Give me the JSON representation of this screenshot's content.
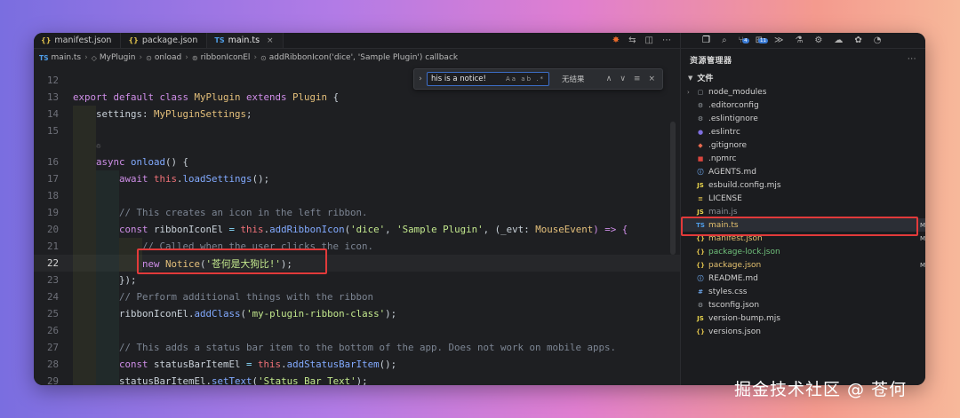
{
  "tabs": [
    {
      "icon": "{}",
      "label": "manifest.json"
    },
    {
      "icon": "{}",
      "label": "package.json"
    },
    {
      "icon": "TS",
      "label": "main.ts",
      "close": "×"
    }
  ],
  "breadcrumb": [
    "main.ts",
    "MyPlugin",
    "onload",
    "ribbonIconEl",
    "addRibbonIcon('dice', 'Sample Plugin') callback"
  ],
  "find": {
    "query": "his is a notice!",
    "options": "Aa ab .*",
    "result": "无结果",
    "chevron": "›"
  },
  "codelens": "♲ ",
  "code": {
    "line_numbers": [
      "12",
      "13",
      "14",
      "15",
      "",
      "16",
      "17",
      "18",
      "19",
      "20",
      "21",
      "22",
      "23",
      "24",
      "25",
      "26",
      "27",
      "28",
      "29"
    ],
    "l13": {
      "a": "export default class ",
      "b": "MyPlugin",
      "c": " extends ",
      "d": "Plugin",
      "e": " {"
    },
    "l14": {
      "a": "settings",
      "b": ": ",
      "c": "MyPluginSettings",
      "d": ";"
    },
    "l16": {
      "a": "async ",
      "b": "onload",
      "c": "() {"
    },
    "l17": {
      "a": "await ",
      "b": "this",
      "c": ".",
      "d": "loadSettings",
      "e": "();"
    },
    "l19": "// This creates an icon in the left ribbon.",
    "l20": {
      "a": "const ",
      "b": "ribbonIconEl",
      "c": " = ",
      "d": "this",
      "e": ".",
      "f": "addRibbonIcon",
      "g": "(",
      "h": "'dice'",
      "i": ", ",
      "j": "'Sample Plugin'",
      "k": ", (",
      "l": "_evt",
      "m": ": ",
      "n": "MouseEvent",
      "o": ") => {"
    },
    "l21": "// Called when the user clicks the icon.",
    "l22": {
      "a": "new ",
      "b": "Notice",
      "c": "(",
      "d": "'苍何是大狗比!'",
      "e": ");"
    },
    "l23": "});",
    "l24": "// Perform additional things with the ribbon",
    "l25": {
      "a": "ribbonIconEl",
      "b": ".",
      "c": "addClass",
      "d": "(",
      "e": "'my-plugin-ribbon-class'",
      "f": ");"
    },
    "l27": "// This adds a status bar item to the bottom of the app. Does not work on mobile apps.",
    "l28": {
      "a": "const ",
      "b": "statusBarItemEl",
      "c": " = ",
      "d": "this",
      "e": ".",
      "f": "addStatusBarItem",
      "g": "();"
    },
    "l29": {
      "a": "statusBarItemEl",
      "b": ".",
      "c": "setText",
      "d": "(",
      "e": "'Status Bar Text'",
      "f": ");"
    }
  },
  "sidebar": {
    "title": "资源管理器",
    "more": "···",
    "section": "文件",
    "items": [
      {
        "icon": "▢",
        "name": "node_modules",
        "folder": true
      },
      {
        "icon": "⚙",
        "name": ".editorconfig"
      },
      {
        "icon": "⚙",
        "name": ".eslintignore"
      },
      {
        "icon": "●",
        "name": ".eslintrc"
      },
      {
        "icon": "◆",
        "name": ".gitignore"
      },
      {
        "icon": "■",
        "name": ".npmrc"
      },
      {
        "icon": "ⓘ",
        "name": "AGENTS.md"
      },
      {
        "icon": "JS",
        "name": "esbuild.config.mjs"
      },
      {
        "icon": "≡",
        "name": "LICENSE"
      },
      {
        "icon": "JS",
        "name": "main.js"
      },
      {
        "icon": "TS",
        "name": "main.ts",
        "status": "M"
      },
      {
        "icon": "{}",
        "name": "manifest.json",
        "status": "M"
      },
      {
        "icon": "{}",
        "name": "package-lock.json"
      },
      {
        "icon": "{}",
        "name": "package.json",
        "status": "M"
      },
      {
        "icon": "ⓘ",
        "name": "README.md"
      },
      {
        "icon": "#",
        "name": "styles.css"
      },
      {
        "icon": "⚙",
        "name": "tsconfig.json"
      },
      {
        "icon": "JS",
        "name": "version-bump.mjs"
      },
      {
        "icon": "{}",
        "name": "versions.json"
      }
    ]
  },
  "watermark": "掘金技术社区 @ 苍何"
}
